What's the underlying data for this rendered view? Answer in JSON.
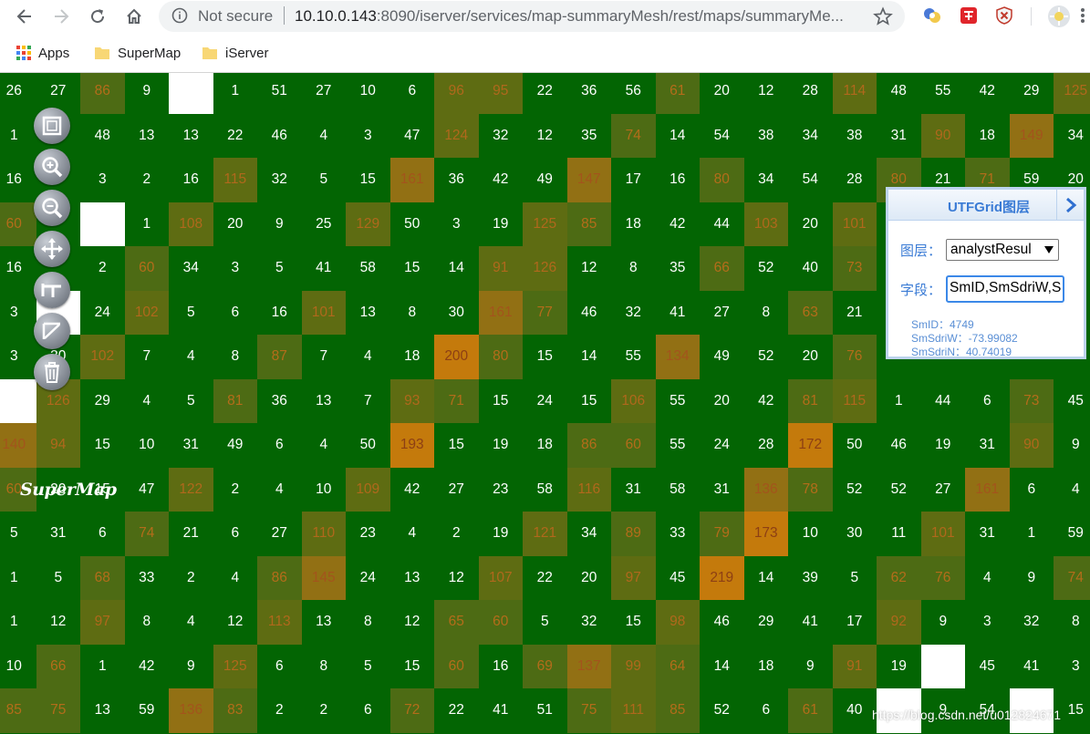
{
  "browser": {
    "security_label": "Not secure",
    "url_host": "10.10.0.143",
    "url_rest": ":8090/iserver/services/map-summaryMesh/rest/maps/summaryMe...",
    "bookmarks": [
      "Apps",
      "SuperMap",
      "iServer"
    ]
  },
  "map": {
    "background": "#036503",
    "grid": [
      [
        26,
        27,
        86,
        9,
        "",
        1,
        51,
        27,
        10,
        6,
        96,
        95,
        22,
        36,
        56,
        61,
        20,
        12,
        28,
        114,
        48,
        55,
        42,
        29,
        125
      ],
      [
        1,
        "",
        48,
        13,
        13,
        22,
        46,
        4,
        3,
        47,
        124,
        32,
        12,
        35,
        74,
        14,
        54,
        38,
        34,
        38,
        31,
        90,
        18,
        149,
        34
      ],
      [
        16,
        "",
        3,
        2,
        16,
        115,
        32,
        5,
        15,
        161,
        36,
        42,
        49,
        147,
        17,
        16,
        80,
        34,
        54,
        28,
        80,
        21,
        71,
        59,
        20
      ],
      [
        60,
        "",
        "",
        1,
        108,
        20,
        9,
        25,
        129,
        50,
        3,
        19,
        125,
        85,
        18,
        42,
        44,
        103,
        20,
        101,
        "",
        "",
        "",
        "",
        ""
      ],
      [
        16,
        "",
        2,
        60,
        34,
        3,
        5,
        41,
        58,
        15,
        14,
        91,
        126,
        12,
        8,
        35,
        66,
        52,
        40,
        73,
        "",
        "",
        "",
        "",
        ""
      ],
      [
        3,
        "",
        24,
        102,
        5,
        6,
        16,
        101,
        13,
        8,
        30,
        161,
        77,
        46,
        32,
        41,
        27,
        8,
        63,
        21,
        "",
        "",
        "",
        "",
        ""
      ],
      [
        3,
        30,
        102,
        7,
        4,
        8,
        87,
        7,
        4,
        18,
        200,
        80,
        15,
        14,
        55,
        134,
        49,
        52,
        20,
        76,
        "",
        "",
        "",
        "",
        ""
      ],
      [
        "",
        126,
        29,
        4,
        5,
        81,
        36,
        13,
        7,
        93,
        71,
        15,
        24,
        15,
        106,
        55,
        20,
        42,
        81,
        115,
        1,
        44,
        6,
        73,
        45
      ],
      [
        140,
        94,
        15,
        10,
        31,
        49,
        6,
        4,
        50,
        193,
        15,
        19,
        18,
        86,
        60,
        55,
        24,
        28,
        172,
        50,
        46,
        19,
        31,
        90,
        9
      ],
      [
        60,
        20,
        15,
        47,
        122,
        2,
        4,
        10,
        109,
        42,
        27,
        23,
        58,
        116,
        31,
        58,
        31,
        136,
        78,
        52,
        52,
        27,
        161,
        6,
        4
      ],
      [
        5,
        31,
        6,
        74,
        21,
        6,
        27,
        110,
        23,
        4,
        2,
        19,
        121,
        34,
        89,
        33,
        79,
        173,
        10,
        30,
        11,
        101,
        31,
        1,
        59
      ],
      [
        1,
        5,
        68,
        33,
        2,
        4,
        86,
        145,
        24,
        13,
        12,
        107,
        22,
        20,
        97,
        45,
        219,
        14,
        39,
        5,
        62,
        76,
        4,
        9,
        74
      ],
      [
        1,
        12,
        97,
        8,
        4,
        12,
        113,
        13,
        8,
        12,
        65,
        60,
        5,
        32,
        15,
        98,
        46,
        29,
        41,
        17,
        92,
        9,
        3,
        32,
        8
      ],
      [
        10,
        66,
        1,
        42,
        9,
        125,
        6,
        8,
        5,
        15,
        60,
        16,
        69,
        137,
        99,
        64,
        14,
        18,
        9,
        91,
        19,
        "",
        45,
        41,
        3
      ],
      [
        85,
        75,
        13,
        59,
        136,
        83,
        2,
        2,
        6,
        72,
        22,
        41,
        51,
        75,
        111,
        85,
        52,
        6,
        61,
        40,
        "",
        9,
        54,
        "",
        15
      ]
    ],
    "white_cells": [
      [
        0,
        4
      ],
      [
        3,
        2
      ],
      [
        5,
        1
      ],
      [
        7,
        0
      ],
      [
        13,
        21
      ],
      [
        14,
        20
      ],
      [
        14,
        23
      ]
    ]
  },
  "controls": {
    "icons": [
      "fullscreen-icon",
      "zoom-in-icon",
      "zoom-out-icon",
      "pan-icon",
      "measure-distance-icon",
      "measure-area-icon",
      "clear-icon"
    ],
    "logo": "SuperMap"
  },
  "panel": {
    "title": "UTFGrid图层",
    "layer_label": "图层：",
    "layer_value": "analystResul",
    "field_label": "字段：",
    "field_value": "SmID,SmSdriW,S",
    "info": [
      "SmID：4749",
      "SmSdriW：-73.99082",
      "SmSdriN：40.74019"
    ]
  },
  "watermark": "https://blog.csdn.net/u012824671"
}
